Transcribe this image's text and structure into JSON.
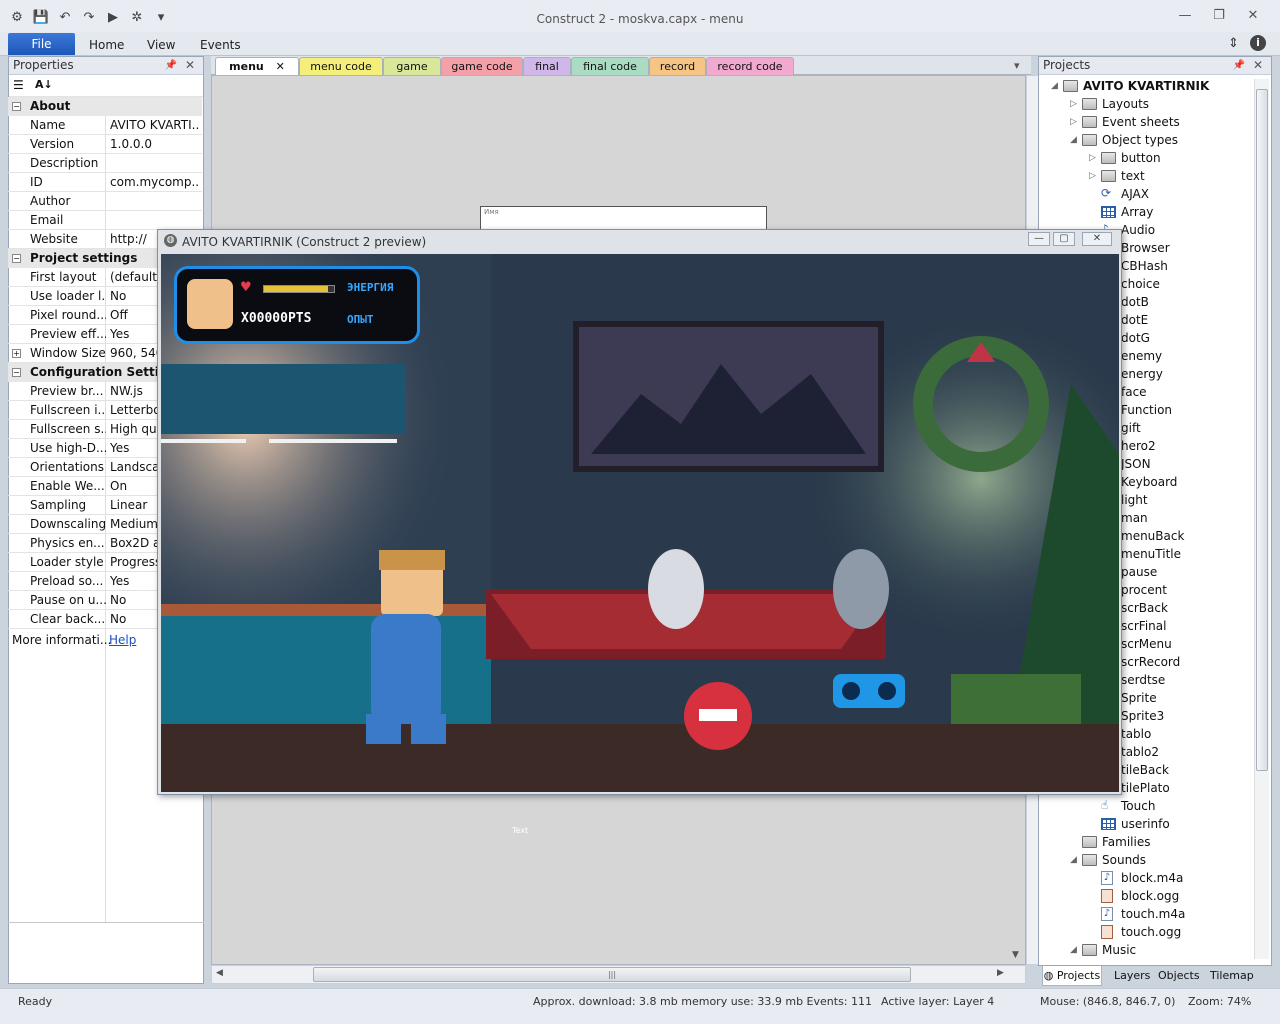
{
  "window": {
    "title": "Construct 2 - moskva.capx - menu"
  },
  "window_controls": {
    "minimize": "—",
    "restore": "❐",
    "close": "✕"
  },
  "quick_access": {
    "dropdown": "▾"
  },
  "ribbon": {
    "file": "File",
    "tabs": [
      "Home",
      "View",
      "Events"
    ],
    "collapse": "⇕",
    "help": "i"
  },
  "properties": {
    "title": "Properties",
    "pin": "📌",
    "close": "✕",
    "rows": [
      {
        "type": "section",
        "label": "About",
        "expander": "−"
      },
      {
        "type": "row",
        "key": "Name",
        "value": "AVITO KVARTI..."
      },
      {
        "type": "row",
        "key": "Version",
        "value": "1.0.0.0"
      },
      {
        "type": "row",
        "key": "Description",
        "value": ""
      },
      {
        "type": "row",
        "key": "ID",
        "value": "com.mycomp..."
      },
      {
        "type": "row",
        "key": "Author",
        "value": ""
      },
      {
        "type": "row",
        "key": "Email",
        "value": ""
      },
      {
        "type": "row",
        "key": "Website",
        "value": "http://"
      },
      {
        "type": "section",
        "label": "Project settings",
        "expander": "−"
      },
      {
        "type": "row",
        "key": "First layout",
        "value": "(default)"
      },
      {
        "type": "row",
        "key": "Use loader l...",
        "value": "No"
      },
      {
        "type": "row",
        "key": "Pixel round...",
        "value": "Off"
      },
      {
        "type": "row",
        "key": "Preview eff...",
        "value": "Yes"
      },
      {
        "type": "row",
        "key": "Window Size",
        "value": "960, 540",
        "expander": "+"
      },
      {
        "type": "section",
        "label": "Configuration Settings",
        "expander": "−"
      },
      {
        "type": "row",
        "key": "Preview br...",
        "value": "NW.js"
      },
      {
        "type": "row",
        "key": "Fullscreen i...",
        "value": "Letterbox"
      },
      {
        "type": "row",
        "key": "Fullscreen s...",
        "value": "High qua"
      },
      {
        "type": "row",
        "key": "Use high-D...",
        "value": "Yes"
      },
      {
        "type": "row",
        "key": "Orientations",
        "value": "Landscap"
      },
      {
        "type": "row",
        "key": "Enable We...",
        "value": "On"
      },
      {
        "type": "row",
        "key": "Sampling",
        "value": "Linear"
      },
      {
        "type": "row",
        "key": "Downscaling",
        "value": "Medium"
      },
      {
        "type": "row",
        "key": "Physics en...",
        "value": "Box2D as"
      },
      {
        "type": "row",
        "key": "Loader style",
        "value": "Progress"
      },
      {
        "type": "row",
        "key": "Preload so...",
        "value": "Yes"
      },
      {
        "type": "row",
        "key": "Pause on u...",
        "value": "No"
      },
      {
        "type": "row",
        "key": "Clear back...",
        "value": "No"
      }
    ],
    "more_info": "More informati...",
    "help_link": "Help"
  },
  "editor": {
    "tabs": [
      {
        "label": "menu",
        "color": "#ffffff",
        "close": "✕"
      },
      {
        "label": "menu code",
        "color": "#f4ef7a"
      },
      {
        "label": "game",
        "color": "#d9e79a"
      },
      {
        "label": "game code",
        "color": "#f4a0a8"
      },
      {
        "label": "final",
        "color": "#cfb7ea"
      },
      {
        "label": "final code",
        "color": "#a9dcc2"
      },
      {
        "label": "record",
        "color": "#f6c484"
      },
      {
        "label": "record code",
        "color": "#f2a9d0"
      }
    ],
    "tab_dropdown": "▾",
    "canvas_label_top": "Имя",
    "canvas_label_bottom": "Text",
    "scroll_up": "▲",
    "scroll_down": "▼",
    "scroll_left": "◀",
    "scroll_right": "▶",
    "grip": "|||"
  },
  "preview": {
    "title": "AVITO KVARTIRNIK (Construct 2 preview)",
    "hud": {
      "energy": "ЭНЕРГИЯ",
      "exp": "ОПЫТ",
      "score": "X00000PTS",
      "energy_level": 0.92
    }
  },
  "projects": {
    "title": "Projects",
    "pin": "📌",
    "close": "✕",
    "tree": [
      {
        "label": "AVITO KVARTIRNIK",
        "depth": 0,
        "icon": "folder",
        "twisty": "◢",
        "bold": true
      },
      {
        "label": "Layouts",
        "depth": 1,
        "icon": "folder",
        "twisty": "▷"
      },
      {
        "label": "Event sheets",
        "depth": 1,
        "icon": "folder",
        "twisty": "▷"
      },
      {
        "label": "Object types",
        "depth": 1,
        "icon": "folder",
        "twisty": "◢"
      },
      {
        "label": "button",
        "depth": 2,
        "icon": "folder",
        "twisty": "▷"
      },
      {
        "label": "text",
        "depth": 2,
        "icon": "folder",
        "twisty": "▷"
      },
      {
        "label": "AJAX",
        "depth": 2,
        "icon": "sym",
        "glyph": "⟳"
      },
      {
        "label": "Array",
        "depth": 2,
        "icon": "grid"
      },
      {
        "label": "Audio",
        "depth": 2,
        "icon": "sym",
        "glyph": "♪"
      },
      {
        "label": "Browser",
        "depth": 2,
        "icon": "sym",
        "glyph": "◍"
      },
      {
        "label": "CBHash",
        "depth": 2,
        "icon": "sym",
        "glyph": "#"
      },
      {
        "label": "choice",
        "depth": 2,
        "icon": "sym",
        "glyph": "▪"
      },
      {
        "label": "dotB",
        "depth": 2,
        "icon": "sym",
        "glyph": "▪"
      },
      {
        "label": "dotE",
        "depth": 2,
        "icon": "sym",
        "glyph": "▪"
      },
      {
        "label": "dotG",
        "depth": 2,
        "icon": "sym",
        "glyph": "▪"
      },
      {
        "label": "enemy",
        "depth": 2,
        "icon": "sym",
        "glyph": "▪"
      },
      {
        "label": "energy",
        "depth": 2,
        "icon": "sym",
        "glyph": "▪"
      },
      {
        "label": "face",
        "depth": 2,
        "icon": "sym",
        "glyph": "▪"
      },
      {
        "label": "Function",
        "depth": 2,
        "icon": "sym",
        "glyph": "ƒ"
      },
      {
        "label": "gift",
        "depth": 2,
        "icon": "sym",
        "glyph": "▪"
      },
      {
        "label": "hero2",
        "depth": 2,
        "icon": "sym",
        "glyph": "▪"
      },
      {
        "label": "JSON",
        "depth": 2,
        "icon": "sym",
        "glyph": "{}"
      },
      {
        "label": "Keyboard",
        "depth": 2,
        "icon": "sym",
        "glyph": "⌨"
      },
      {
        "label": "light",
        "depth": 2,
        "icon": "sym",
        "glyph": "▪"
      },
      {
        "label": "man",
        "depth": 2,
        "icon": "sym",
        "glyph": "▪"
      },
      {
        "label": "menuBack",
        "depth": 2,
        "icon": "sym",
        "glyph": "▪"
      },
      {
        "label": "menuTitle",
        "depth": 2,
        "icon": "sym",
        "glyph": "▪"
      },
      {
        "label": "pause",
        "depth": 2,
        "icon": "sym",
        "glyph": "▪"
      },
      {
        "label": "procent",
        "depth": 2,
        "icon": "sym",
        "glyph": "▪"
      },
      {
        "label": "scrBack",
        "depth": 2,
        "icon": "sym",
        "glyph": "▪"
      },
      {
        "label": "scrFinal",
        "depth": 2,
        "icon": "sym",
        "glyph": "▪"
      },
      {
        "label": "scrMenu",
        "depth": 2,
        "icon": "sym",
        "glyph": "▪"
      },
      {
        "label": "scrRecord",
        "depth": 2,
        "icon": "sym",
        "glyph": "▪"
      },
      {
        "label": "serdtse",
        "depth": 2,
        "icon": "sym",
        "glyph": "▪"
      },
      {
        "label": "Sprite",
        "depth": 2,
        "icon": "sym",
        "glyph": "▪"
      },
      {
        "label": "Sprite3",
        "depth": 2,
        "icon": "sym",
        "glyph": "▪"
      },
      {
        "label": "tablo",
        "depth": 2,
        "icon": "sym",
        "glyph": "▪"
      },
      {
        "label": "tablo2",
        "depth": 2,
        "icon": "sym",
        "glyph": "▪"
      },
      {
        "label": "tileBack",
        "depth": 2,
        "icon": "sym",
        "glyph": "▪"
      },
      {
        "label": "tilePlato",
        "depth": 2,
        "icon": "sym",
        "glyph": "▪"
      },
      {
        "label": "Touch",
        "depth": 2,
        "icon": "sym",
        "glyph": "☝"
      },
      {
        "label": "userinfo",
        "depth": 2,
        "icon": "grid"
      },
      {
        "label": "Families",
        "depth": 1,
        "icon": "folder"
      },
      {
        "label": "Sounds",
        "depth": 1,
        "icon": "folder",
        "twisty": "◢"
      },
      {
        "label": "block.m4a",
        "depth": 2,
        "icon": "note"
      },
      {
        "label": "block.ogg",
        "depth": 2,
        "icon": "ogg"
      },
      {
        "label": "touch.m4a",
        "depth": 2,
        "icon": "note"
      },
      {
        "label": "touch.ogg",
        "depth": 2,
        "icon": "ogg"
      },
      {
        "label": "Music",
        "depth": 1,
        "icon": "folder",
        "twisty": "◢"
      }
    ],
    "bottom_tabs": [
      "Projects",
      "Layers",
      "Objects",
      "Tilemap"
    ]
  },
  "status": {
    "ready": "Ready",
    "download": "Approx. download: 3.8 mb  memory use: 33.9 mb  Events: 111",
    "layer": "Active layer: Layer 4",
    "mouse": "Mouse: (846.8, 846.7, 0)",
    "zoom": "Zoom: 74%"
  }
}
